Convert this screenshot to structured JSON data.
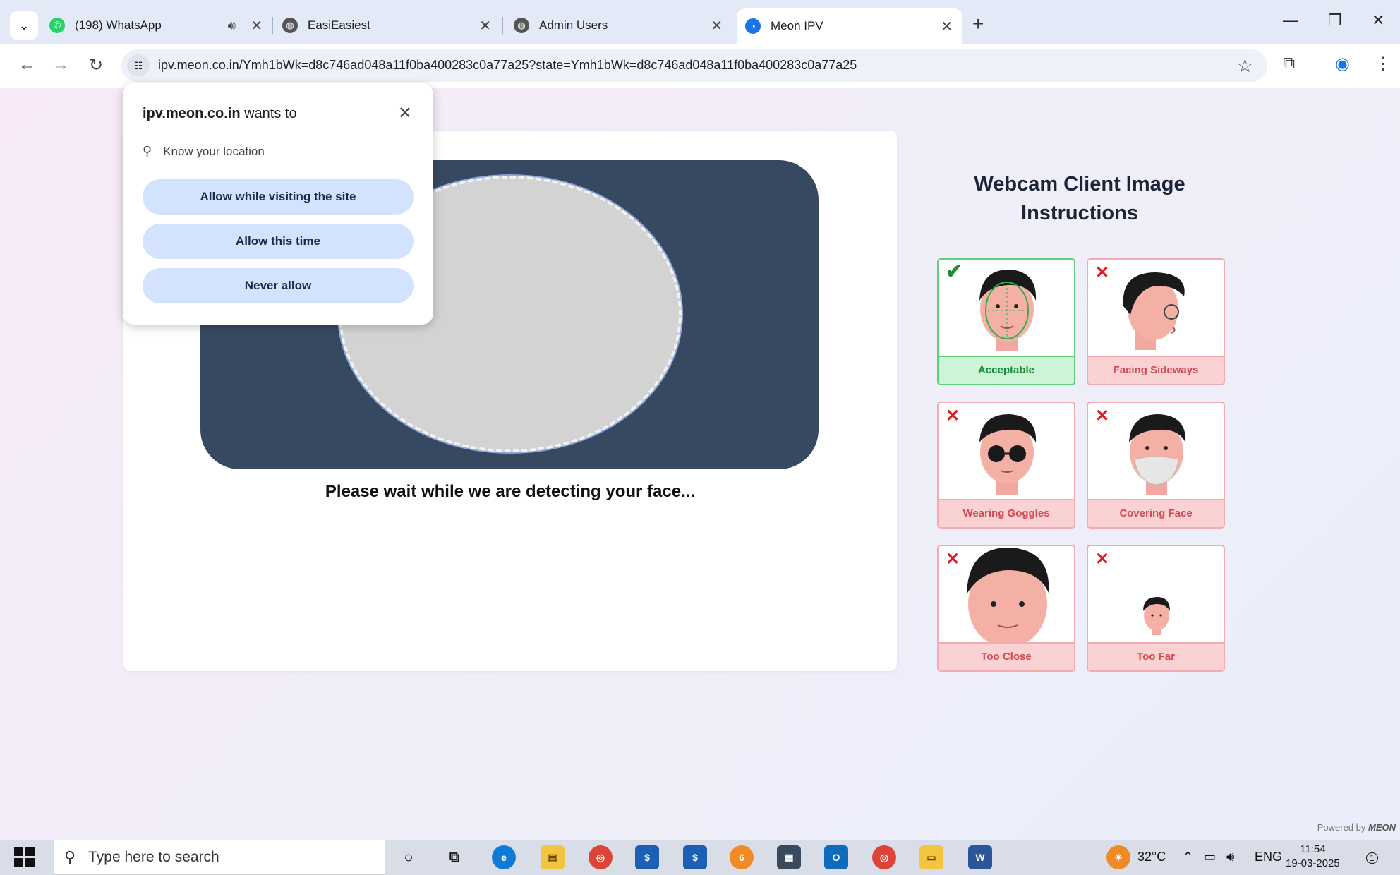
{
  "browser": {
    "tabs": [
      {
        "title": "(198) WhatsApp",
        "icon": "whatsapp-icon",
        "audio": true
      },
      {
        "title": "EasiEasiest",
        "icon": "globe-icon"
      },
      {
        "title": "Admin Users",
        "icon": "globe-icon"
      },
      {
        "title": "Meon IPV",
        "icon": "meon-icon",
        "active": true
      }
    ],
    "url": "ipv.meon.co.in/Ymh1bWk=d8c746ad048a11f0ba400283c0a77a25?state=Ymh1bWk=d8c746ad048a11f0ba400283c0a77a25"
  },
  "permission": {
    "site": "ipv.meon.co.in",
    "wants_to": "wants to",
    "request": "Know your location",
    "buttons": {
      "allow_visiting": "Allow while visiting the site",
      "allow_once": "Allow this time",
      "never": "Never allow"
    }
  },
  "webcam": {
    "status_message": "Please wait while we are detecting your face..."
  },
  "instructions": {
    "title": "Webcam Client Image Instructions",
    "items": [
      {
        "label": "Acceptable",
        "status": "acceptable"
      },
      {
        "label": "Facing Sideways",
        "status": "rejected"
      },
      {
        "label": "Wearing Goggles",
        "status": "rejected"
      },
      {
        "label": "Covering Face",
        "status": "rejected"
      },
      {
        "label": "Too Close",
        "status": "rejected"
      },
      {
        "label": "Too Far",
        "status": "rejected"
      }
    ]
  },
  "footer": {
    "powered_by": "Powered by",
    "brand": "MEON"
  },
  "taskbar": {
    "search_placeholder": "Type here to search",
    "temperature": "32°C",
    "language": "ENG",
    "time": "11:54",
    "date": "19-03-2025",
    "notification_count": "1"
  },
  "colors": {
    "accent_blue": "#d3e3fd",
    "webcam_bg": "#374960",
    "acceptable_green": "#5fcf7c",
    "rejected_red": "#f4aab0"
  }
}
